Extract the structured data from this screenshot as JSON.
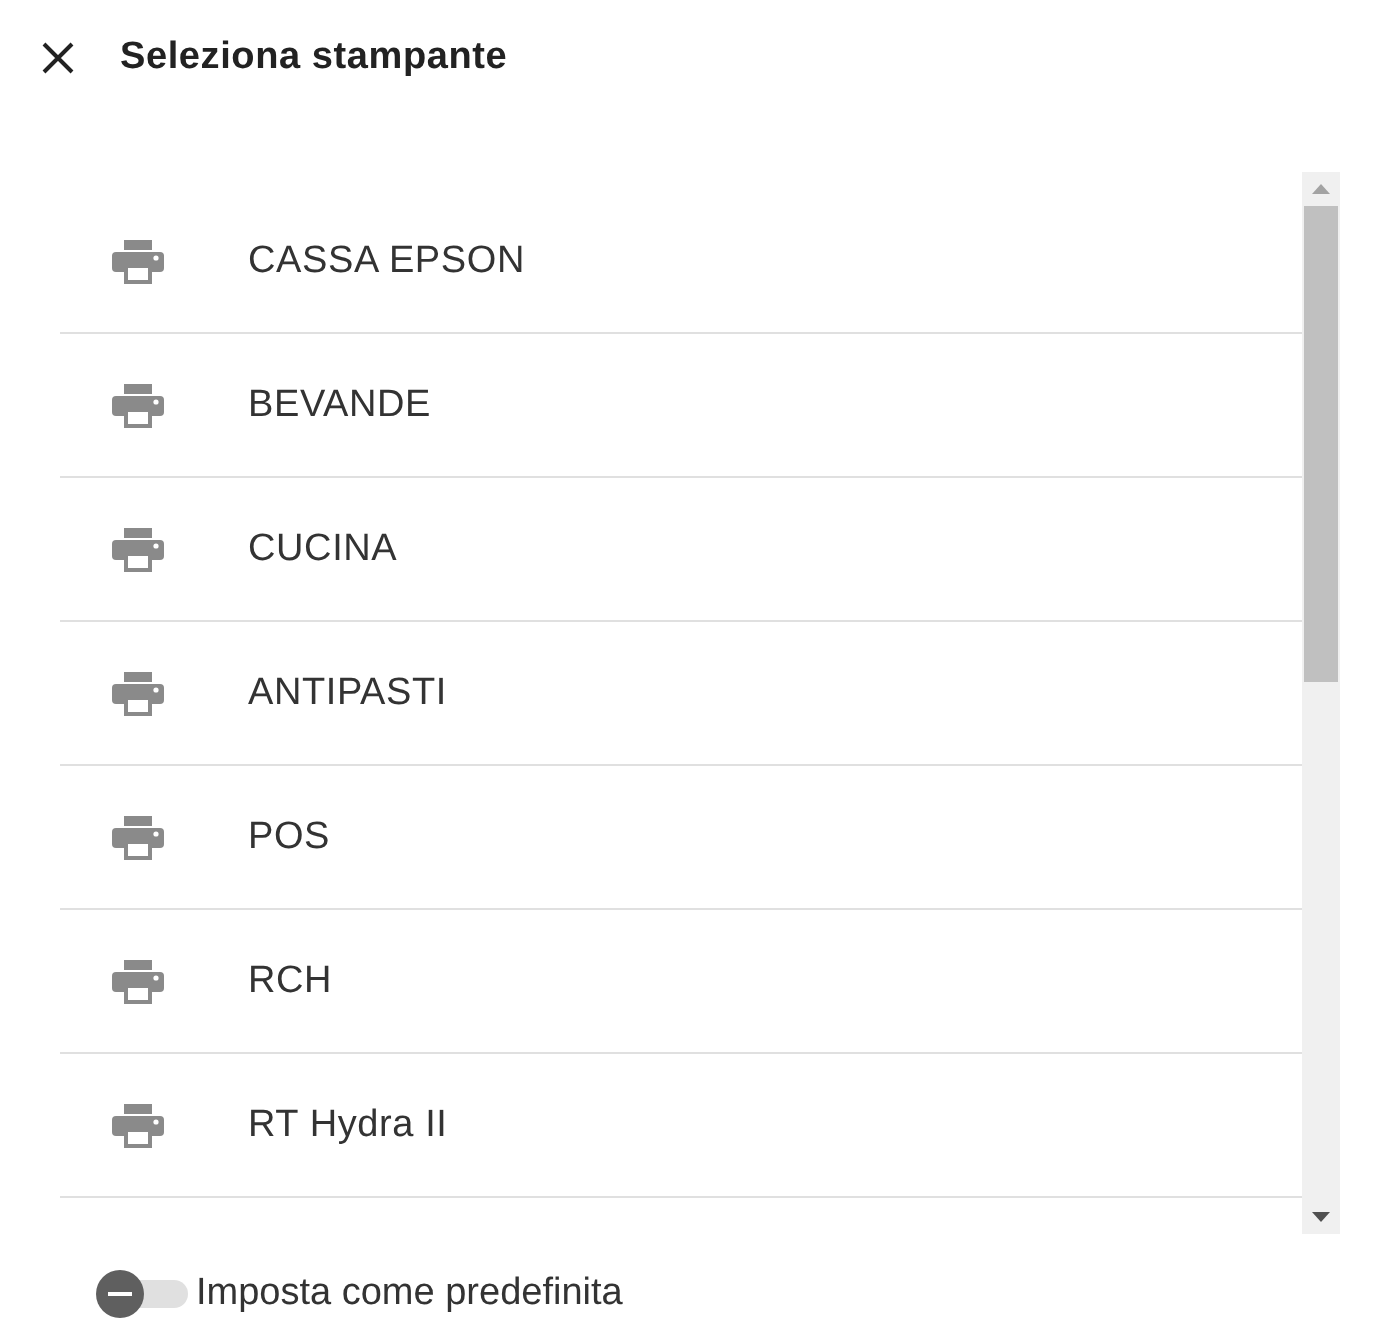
{
  "dialog": {
    "title": "Seleziona stampante"
  },
  "printers": [
    {
      "name": "CASSA EPSON"
    },
    {
      "name": "BEVANDE"
    },
    {
      "name": "CUCINA"
    },
    {
      "name": "ANTIPASTI"
    },
    {
      "name": "POS"
    },
    {
      "name": "RCH"
    },
    {
      "name": "RT Hydra II"
    }
  ],
  "default_toggle": {
    "label": "Imposta come predefinita",
    "on": false
  }
}
